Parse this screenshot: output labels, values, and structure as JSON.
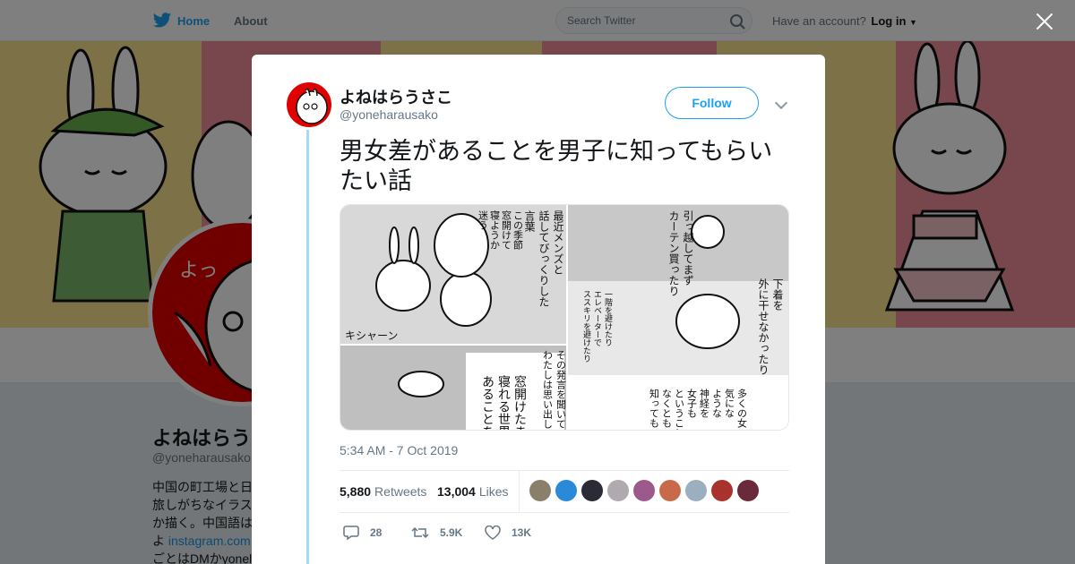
{
  "topbar": {
    "home_label": "Home",
    "about_label": "About",
    "search_placeholder": "Search Twitter",
    "account_prompt": "Have an account?",
    "login_label": "Log in"
  },
  "profile": {
    "name": "よねはらうさこ",
    "handle": "@yoneharausako",
    "bio_lines": [
      "中国の町工場と日",
      "旅しがちなイラス",
      "か描く。中国語は",
      "よ"
    ],
    "bio_link": "instagram.com",
    "bio_last": "ごとはDMかyonel"
  },
  "tweet": {
    "name": "よねはらうさこ",
    "handle": "@yoneharausako",
    "follow_label": "Follow",
    "text": "男女差があることを男子に知ってもらいたい話",
    "timestamp": "5:34 AM - 7 Oct 2019",
    "retweets_count": "5,880",
    "retweets_label": "Retweets",
    "likes_count": "13,004",
    "likes_label": "Likes",
    "reply_count": "28",
    "retweet_action_count": "5.9K",
    "like_action_count": "13K",
    "comic": {
      "panel1": [
        "最近メンズと",
        "話してびっくりした",
        "言葉"
      ],
      "panel1_bubble": [
        "この季節",
        "窓開けて",
        "寝ようか",
        "迷う"
      ],
      "panel1_sfx": "キシャーン",
      "panel2": [
        "引っ越してまず",
        "カーテン買ったり"
      ],
      "panel2b": [
        "一階を避けたり",
        "エレベーターで",
        "ススキリを避けたり"
      ],
      "panel3": [
        "下着を",
        "外に干せなかったり"
      ],
      "panel4": [
        "その発言を聞いて",
        "わたしは思い出して"
      ],
      "panel4_big": [
        "窓開けたまま",
        "寝れる世界",
        "あることを"
      ],
      "panel5": [
        "多くの女",
        "気にな",
        "ような",
        "神経を",
        "女子も",
        "ということ",
        "なくとも",
        "知っても"
      ]
    }
  },
  "liker_colors": [
    "#8a7f6a",
    "#2a8ad8",
    "#2b2b35",
    "#b0aab0",
    "#9c5a8c",
    "#c86a4a",
    "#9ab0c0",
    "#a8332c",
    "#6a2a3a"
  ],
  "colors": {
    "accent": "#1da1f2",
    "thread": "#a4d9f9",
    "banner_yellow": "#f8e28f",
    "banner_pink": "#f08f9c",
    "avatar_red": "#e00000"
  }
}
